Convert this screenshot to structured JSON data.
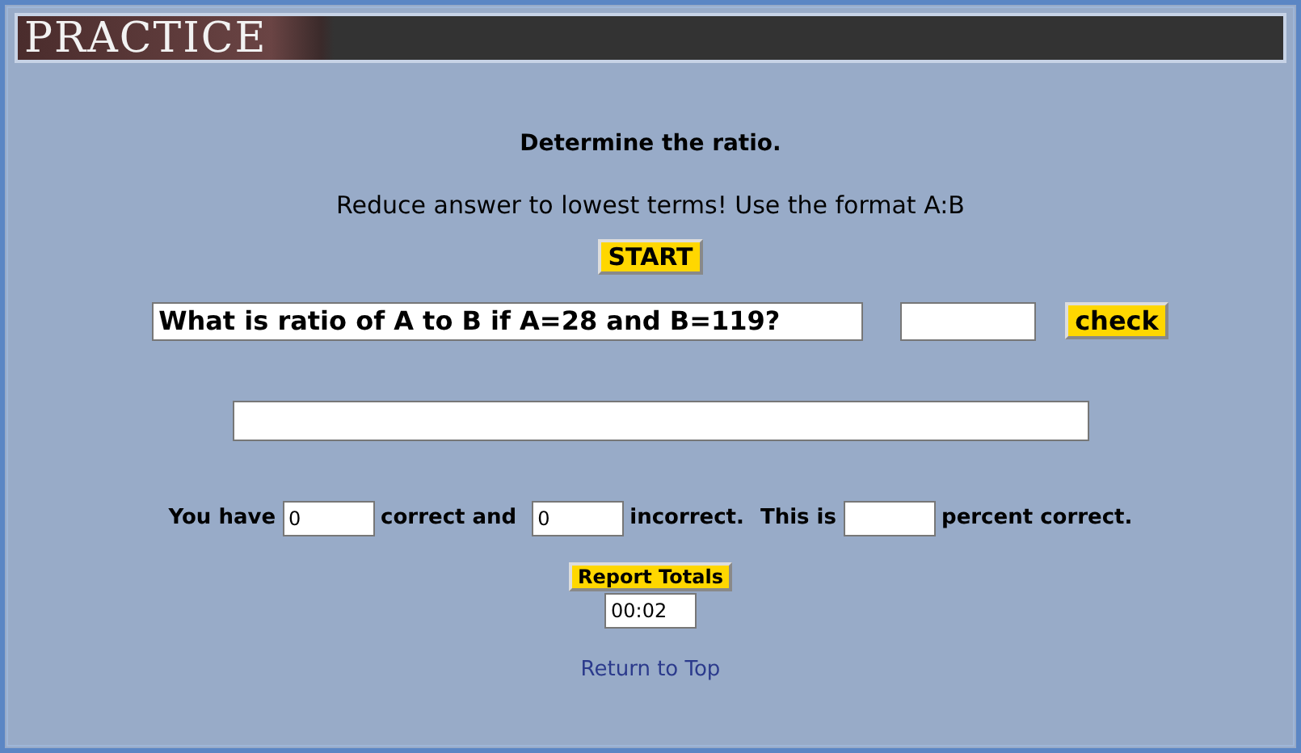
{
  "banner": {
    "title": "PRACTICE"
  },
  "instruction": "Determine the ratio.",
  "hint": "Reduce answer to lowest terms! Use the format A:B",
  "start_button": "START",
  "question": {
    "value": "What is ratio of A to B if A=28 and B=119?"
  },
  "check_button": "check",
  "score": {
    "label_1": "You have",
    "correct": "0",
    "label_2": "correct and",
    "incorrect": "0",
    "label_3": "incorrect.",
    "label_4": "This is",
    "label_5": "percent correct."
  },
  "report_button": "Report Totals",
  "timer": "00:02",
  "link": "Return to Top"
}
